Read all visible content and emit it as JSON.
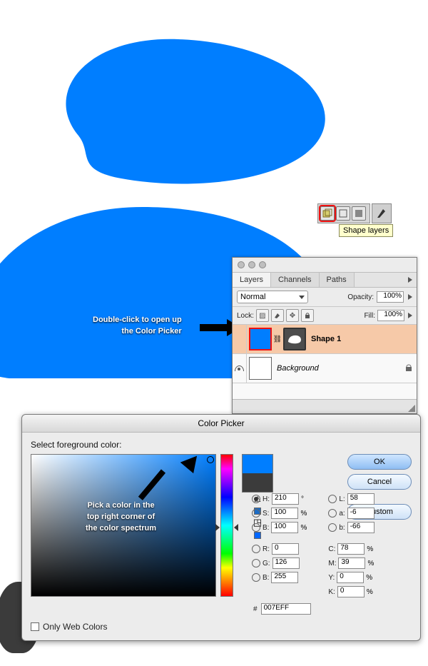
{
  "shape_color": "#007EFF",
  "toolbar": {
    "tooltip": "Shape layers"
  },
  "annotations": {
    "double_click_l1": "Double-click to open up",
    "double_click_l2": "the Color Picker",
    "pick_l1": "Pick a color in the",
    "pick_l2": "top right corner of",
    "pick_l3": "the color spectrum"
  },
  "layers_panel": {
    "tabs": {
      "layers": "Layers",
      "channels": "Channels",
      "paths": "Paths"
    },
    "blend_mode": "Normal",
    "opacity_label": "Opacity:",
    "opacity_value": "100%",
    "lock_label": "Lock:",
    "fill_label": "Fill:",
    "fill_value": "100%",
    "layers": [
      {
        "name": "Shape 1",
        "selected": true,
        "thumb_color": "#007EFF"
      },
      {
        "name": "Background",
        "selected": false,
        "thumb_color": "#FFFFFF"
      }
    ]
  },
  "color_picker": {
    "title": "Color Picker",
    "subtitle": "Select foreground color:",
    "buttons": {
      "ok": "OK",
      "cancel": "Cancel",
      "custom": "Custom"
    },
    "hsb": {
      "H": "210",
      "S": "100",
      "B": "100"
    },
    "lab": {
      "L": "58",
      "a": "-6",
      "b": "-66"
    },
    "rgb": {
      "R": "0",
      "G": "126",
      "B": "255"
    },
    "cmyk": {
      "C": "78",
      "M": "39",
      "Y": "0",
      "K": "0"
    },
    "hex": "007EFF",
    "only_web": "Only Web Colors",
    "deg": "°",
    "pct": "%",
    "hash": "#",
    "lbl": {
      "H": "H:",
      "S": "S:",
      "B": "B:",
      "L": "L:",
      "a": "a:",
      "b": "b:",
      "R": "R:",
      "G": "G:",
      "Bb": "B:",
      "C": "C:",
      "M": "M:",
      "Y": "Y:",
      "K": "K:"
    }
  }
}
